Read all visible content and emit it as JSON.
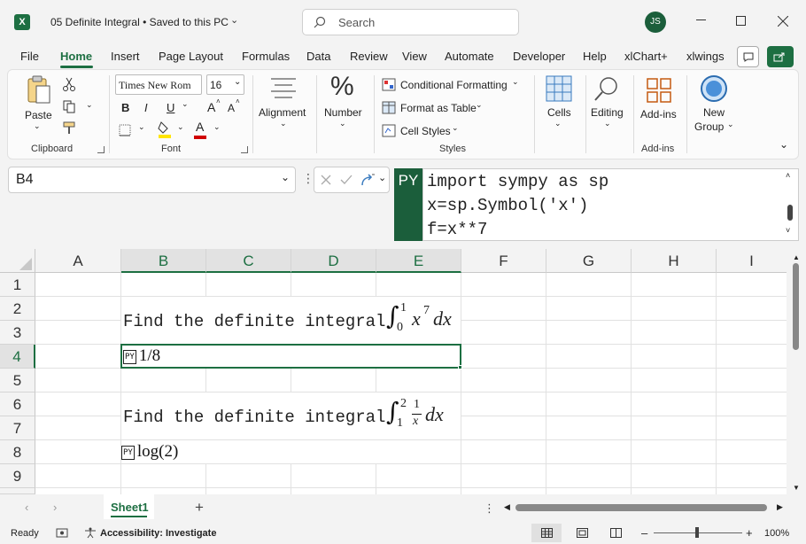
{
  "titlebar": {
    "title": "05 Definite Integral • Saved to this PC",
    "search_placeholder": "Search",
    "avatar": "JS"
  },
  "tabs": [
    "File",
    "Home",
    "Insert",
    "Page Layout",
    "Formulas",
    "Data",
    "Review",
    "View",
    "Automate",
    "Developer",
    "Help",
    "xlChart+",
    "xlwings"
  ],
  "ribbon": {
    "clipboard": {
      "paste": "Paste",
      "label": "Clipboard"
    },
    "font": {
      "name": "Times New Rom",
      "size": "16",
      "label": "Font",
      "bold": "B",
      "italic": "I",
      "underline": "U",
      "grow": "A",
      "shrink": "A",
      "color": "A"
    },
    "alignment": {
      "label": "Alignment"
    },
    "number": {
      "label": "Number",
      "symbol": "%"
    },
    "styles": {
      "conditional": "Conditional Formatting",
      "table": "Format as Table",
      "cell_styles": "Cell Styles",
      "label": "Styles"
    },
    "cells": {
      "label": "Cells"
    },
    "editing": {
      "label": "Editing"
    },
    "addins": {
      "label": "Add-ins",
      "group": "Add-ins"
    },
    "newgroup": {
      "line1": "New",
      "line2": "Group"
    }
  },
  "formula_bar": {
    "name_box": "B4",
    "py": "PY",
    "lines": [
      "import sympy as sp",
      "x=sp.Symbol('x')",
      "f=x**7"
    ]
  },
  "grid": {
    "columns": [
      "A",
      "B",
      "C",
      "D",
      "E",
      "F",
      "G",
      "H",
      "I"
    ],
    "rows": [
      "1",
      "2",
      "3",
      "4",
      "5",
      "6",
      "7",
      "8",
      "9"
    ],
    "problem1": {
      "text": "Find the definite integral",
      "upper": "1",
      "lower": "0",
      "integrand": "x",
      "exp": "7",
      "dx": "dx"
    },
    "result1": {
      "badge": "PY",
      "value": "1/8"
    },
    "problem2": {
      "text": "Find the definite integral",
      "upper": "2",
      "lower": "1",
      "num": "1",
      "den": "x",
      "dx": "dx"
    },
    "result2": {
      "badge": "PY",
      "value": "log(2)"
    }
  },
  "sheets": {
    "active": "Sheet1",
    "add": "+"
  },
  "status": {
    "ready": "Ready",
    "accessibility": "Accessibility: Investigate",
    "zoom": "100%",
    "minus": "–",
    "plus": "+"
  }
}
